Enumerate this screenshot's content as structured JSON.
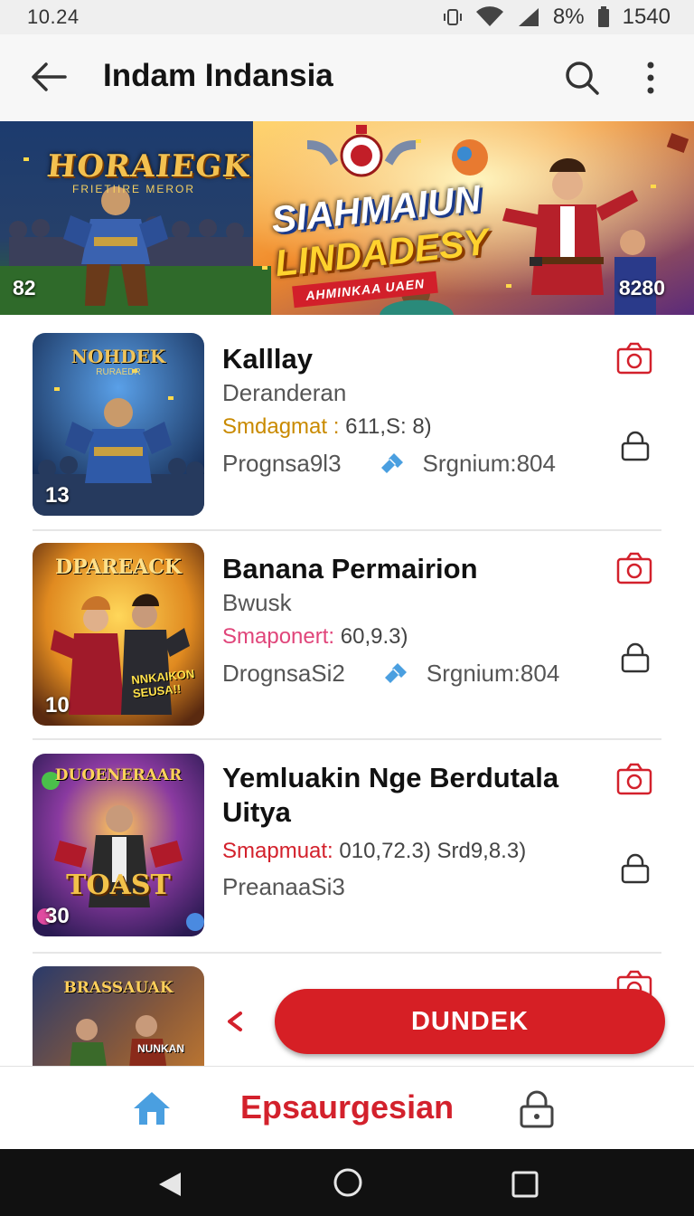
{
  "status_bar": {
    "time": "10.24",
    "battery_pct": "8%",
    "battery_num": "1540"
  },
  "app_bar": {
    "title": "Indam Indansia"
  },
  "banner": {
    "left_logo": "HORAIEGK",
    "left_logo_sub": "FRIETIIRE MEROR",
    "headline_1": "SIAHMAIUN",
    "headline_2": "LINDADESY",
    "ribbon": "AHMINKAA UAEN",
    "left_badge": "82",
    "right_badge": "8280"
  },
  "games": [
    {
      "thumb_title": "NOHDEK",
      "thumb_sub": "RURAEDR",
      "thumb_badge": "13",
      "name": "Kalllay",
      "subtitle": "Deranderan",
      "stat_label": "Smdagmat :",
      "stat_label_color": "#c98a00",
      "stat_value": "611,S: 8)",
      "meta_left": "Prognsa9l3",
      "meta_right": "Srgnium:804"
    },
    {
      "thumb_title": "DPAREACK",
      "thumb_sub": "",
      "thumb_badge": "10",
      "thumb_caption": "NNKAIKON SEUSA!!",
      "name": "Banana Permairion",
      "subtitle": "Bwusk",
      "stat_label": "Smaponert:",
      "stat_label_color": "#e0457a",
      "stat_value": "60,9.3)",
      "meta_left": "DrognsaSi2",
      "meta_right": "Srgnium:804"
    },
    {
      "thumb_title": "DUOENERAAR",
      "thumb_sub": "",
      "thumb_badge": "30",
      "thumb_caption": "TOAST",
      "name": "Yemluakin Nge Berdutala Uitya",
      "subtitle": "",
      "stat_label": "Smapmuat:",
      "stat_label_color": "#d3212c",
      "stat_value": "010,72.3) Srd9,8.3)",
      "meta_left": "PreanaaSi3",
      "meta_right": ""
    },
    {
      "thumb_title": "BRASSAUAK",
      "thumb_sub": "",
      "thumb_badge": "",
      "thumb_caption": "NUNKAN",
      "name": "",
      "subtitle": ""
    }
  ],
  "cta": {
    "label": "DUNDEK"
  },
  "bottom_nav": {
    "center_label": "Epsaurgesian"
  },
  "colors": {
    "accent": "#d3212c",
    "home_icon": "#4a9fe0",
    "meta_icon": "#4a9fe0"
  }
}
